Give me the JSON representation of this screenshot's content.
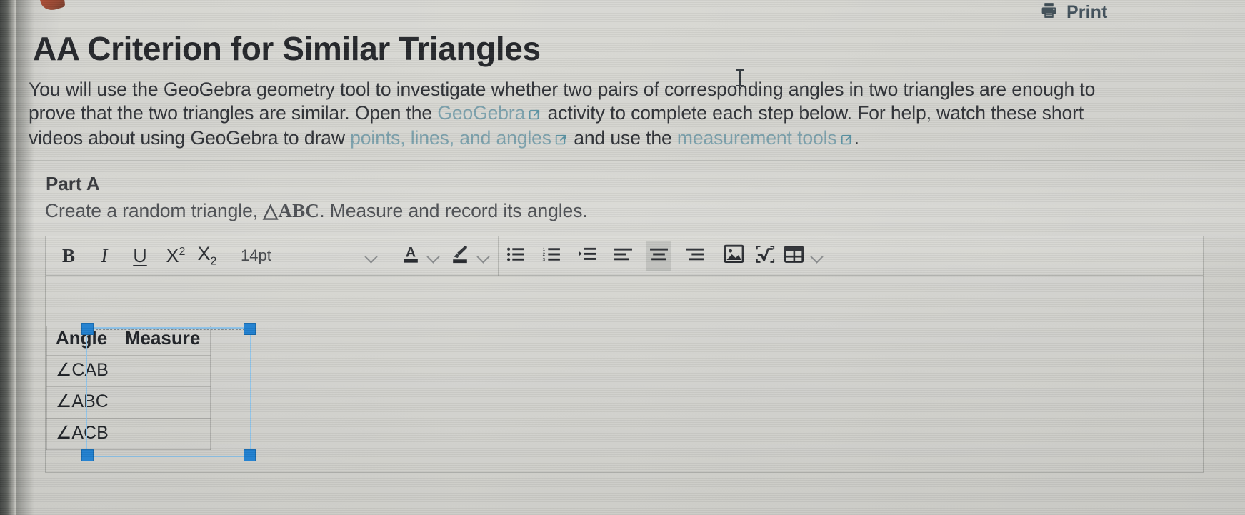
{
  "window": {
    "print_label": "Print",
    "print_icon": "printer-icon"
  },
  "assignment": {
    "title": "AA Criterion for Similar Triangles",
    "intro": {
      "seg1": "You will use the GeoGebra geometry tool to investigate whether two pairs of corresponding angles in two triangles are enough to prove that the two triangles are similar. Open the ",
      "link1": "GeoGebra",
      "seg2": " activity to complete each step below. For help, watch these short videos about using GeoGebra to draw ",
      "link2": "points, lines, and angles",
      "seg3": " and use the ",
      "link3": "measurement tools",
      "seg4": ".",
      "external_link_icon": "external-link-icon"
    }
  },
  "part": {
    "label": "Part A",
    "prompt_before": "Create a random triangle, ",
    "prompt_symbol": "△ABC",
    "prompt_after": ". Measure and record its angles."
  },
  "editor": {
    "toolbar": {
      "bold": "B",
      "italic": "I",
      "underline": "U",
      "superscript_base": "X",
      "superscript_exp": "2",
      "subscript_base": "X",
      "subscript_idx": "2",
      "font_size_value": "14pt",
      "icons": [
        "chevron-down-icon",
        "text-color-icon",
        "chevron-down-icon",
        "highlight-color-icon",
        "chevron-down-icon",
        "bulleted-list-icon",
        "numbered-list-icon",
        "indent-icon",
        "align-left-icon",
        "align-center-icon",
        "align-right-icon",
        "insert-image-icon",
        "insert-equation-icon",
        "insert-table-icon",
        "chevron-down-icon"
      ],
      "active_button": "align-center-icon"
    },
    "table": {
      "headers": [
        "Angle",
        "Measure"
      ],
      "rows": [
        {
          "angle": "∠CAB",
          "measure": ""
        },
        {
          "angle": "∠ABC",
          "measure": ""
        },
        {
          "angle": "∠ACB",
          "measure": ""
        }
      ]
    }
  },
  "colors": {
    "link": "#7ba0ab",
    "text": "#2f3237",
    "title": "#24262a",
    "selection_handle": "#1f7fd0",
    "selection_border": "#8fc3e8",
    "page_bg": "#d4d4cf"
  }
}
